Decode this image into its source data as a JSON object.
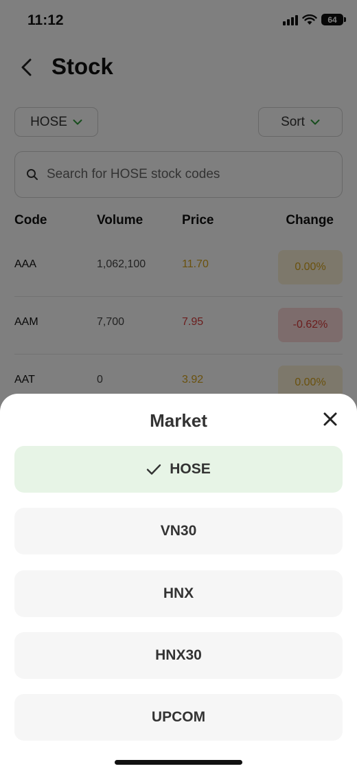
{
  "status_bar": {
    "time": "11:12",
    "battery": "64"
  },
  "header": {
    "title": "Stock"
  },
  "filters": {
    "market_label": "HOSE",
    "sort_label": "Sort"
  },
  "search": {
    "placeholder": "Search for HOSE stock codes"
  },
  "table": {
    "headers": {
      "code": "Code",
      "volume": "Volume",
      "price": "Price",
      "change": "Change"
    },
    "rows": [
      {
        "code": "AAA",
        "volume": "1,062,100",
        "price": "11.70",
        "change": "0.00%",
        "trend": "flat"
      },
      {
        "code": "AAM",
        "volume": "7,700",
        "price": "7.95",
        "change": "-0.62%",
        "trend": "down"
      },
      {
        "code": "AAT",
        "volume": "0",
        "price": "3.92",
        "change": "0.00%",
        "trend": "flat"
      }
    ]
  },
  "colors": {
    "flat": "#d4a21a",
    "down": "#d63a3a",
    "accent": "#2e9b3a",
    "selected_bg": "#e7f4e6"
  },
  "market_sheet": {
    "title": "Market",
    "options": [
      {
        "label": "HOSE",
        "selected": true
      },
      {
        "label": "VN30",
        "selected": false
      },
      {
        "label": "HNX",
        "selected": false
      },
      {
        "label": "HNX30",
        "selected": false
      },
      {
        "label": "UPCOM",
        "selected": false
      }
    ]
  }
}
